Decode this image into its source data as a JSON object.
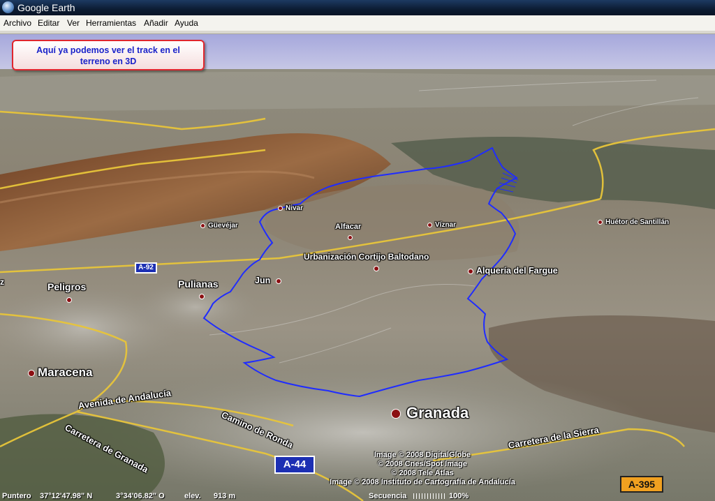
{
  "window": {
    "title": "Google Earth",
    "icon": "globe-icon"
  },
  "menu": [
    "Archivo",
    "Editar",
    "Ver",
    "Herramientas",
    "Añadir",
    "Ayuda"
  ],
  "callout": {
    "line1": "Aquí ya podemos ver el track en el",
    "line2": "terreno en 3D",
    "border_color": "#e0262e",
    "text_color": "#1a22c9"
  },
  "places": {
    "nivar": "Nivar",
    "guevejar": "Güevéjar",
    "alfacar": "Alfacar",
    "viznar": "Víznar",
    "huetor": "Huétor de Santillán",
    "cortijo": "Urbanización Cortijo Baltodano",
    "alqueria": "Alquería del Fargue",
    "jun": "Jun",
    "pulianas": "Pulianas",
    "peligros": "Peligros",
    "maracena": "Maracena",
    "granada": "Granada",
    "edge_z": "z"
  },
  "roads": {
    "a92": "A-92",
    "a44": "A-44",
    "a395": "A-395",
    "avenida": "Avenida de Andalucía",
    "camino": "Camino de Ronda",
    "carretera_granada": "Carretera de Granada",
    "carretera_sierra": "Carretera de la Sierra"
  },
  "credits": [
    "Image © 2008 DigitalGlobe",
    "© 2008 Cnes/Spot Image",
    "© 2008 Tele Atlas",
    "Image © 2008 Instituto de Cartografía de Andalucía"
  ],
  "status": {
    "pointer_label": "Puntero",
    "lat": "37°12'47.98\" N",
    "lon": "3°34'06.82\" O",
    "elev_label": "elev.",
    "elev_value": "913 m",
    "stream_label": "Secuencia",
    "stream_value": "100%"
  },
  "colors": {
    "track": "#1f2cff",
    "road": "#e8c53a",
    "sky": "#b0b2e0"
  }
}
